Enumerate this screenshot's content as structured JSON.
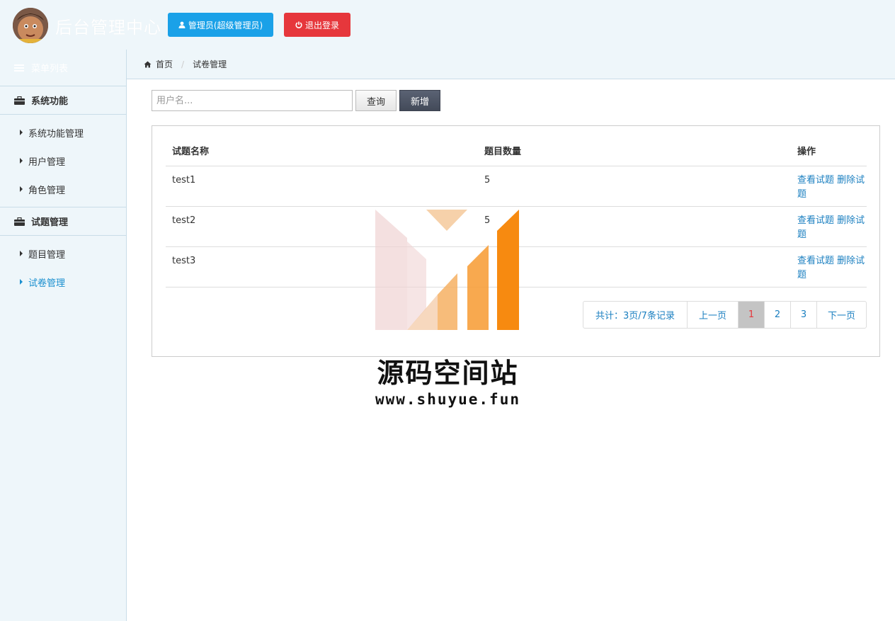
{
  "header": {
    "site_title": "后台管理中心",
    "admin_label": "管理员(超级管理员)",
    "logout_label": "退出登录",
    "admin_color": "#1aa1e8",
    "logout_color": "#e6373c"
  },
  "sidebar": {
    "menu_title": "菜单列表",
    "groups": [
      {
        "label": "系统功能",
        "items": [
          {
            "label": "系统功能管理"
          },
          {
            "label": "用户管理"
          },
          {
            "label": "角色管理"
          }
        ]
      },
      {
        "label": "试题管理",
        "items": [
          {
            "label": "题目管理"
          },
          {
            "label": "试卷管理",
            "active": true
          }
        ]
      }
    ]
  },
  "breadcrumb": {
    "home": "首页",
    "current": "试卷管理"
  },
  "toolbar": {
    "search_placeholder": "用户名...",
    "query_label": "查询",
    "add_label": "新增"
  },
  "table": {
    "columns": [
      "试题名称",
      "题目数量",
      "操作"
    ],
    "rows": [
      {
        "name": "test1",
        "count": "5",
        "view": "查看试题",
        "delete": "删除试题"
      },
      {
        "name": "test2",
        "count": "5",
        "view": "查看试题",
        "delete": "删除试题"
      },
      {
        "name": "test3",
        "count": "",
        "view": "查看试题",
        "delete": "删除试题"
      }
    ]
  },
  "pagination": {
    "total": "共计：3页/7条记录",
    "prev": "上一页",
    "pages": [
      "1",
      "2",
      "3"
    ],
    "current": "1",
    "next": "下一页"
  },
  "watermark": {
    "name": "源码空间站",
    "url": "www.shuyue.fun"
  }
}
